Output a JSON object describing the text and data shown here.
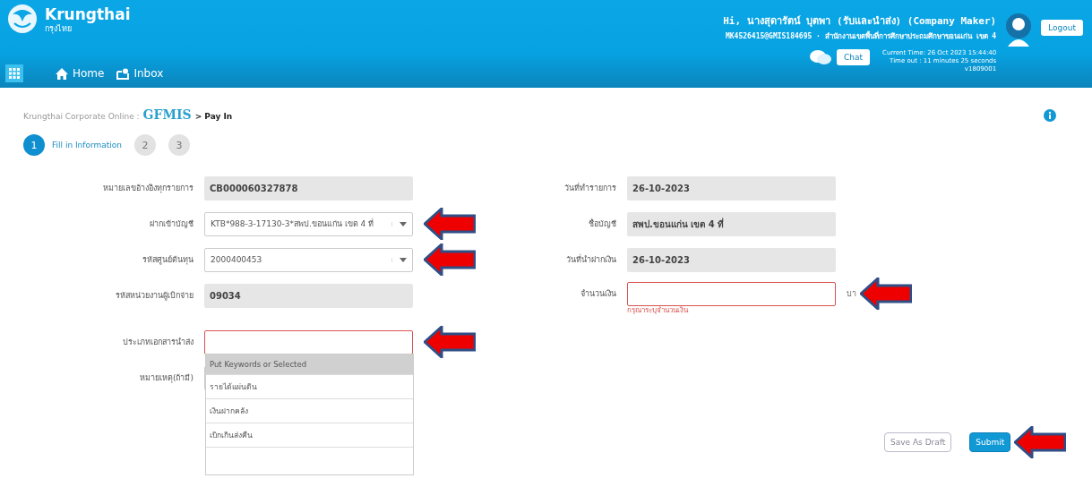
{
  "header": {
    "brand": "Krungthai",
    "brand_sub": "กรุงไทย",
    "nav": [
      {
        "label": "Home"
      },
      {
        "label": "Inbox"
      }
    ],
    "greeting": "Hi, นางสุดารัตน์ บุตพา (รับและนำส่ง) (Company Maker)",
    "user_line": "MK4526415@GMIS184695 · สำนักงานเขตพื้นที่การศึกษาประถมศึกษาขอนแก่น เขต 4",
    "chat_button": "Chat",
    "logout_button": "Logout",
    "current_time": "Current Time: 26 Oct 2023 15:44:40",
    "time_out": "Time out : 11 minutes 25 seconds",
    "version": "v1809001"
  },
  "breadcrumb": {
    "root": "Krungthai Corporate Online :",
    "section": "GFMIS",
    "page": "> Pay In"
  },
  "steps": [
    {
      "number": "1",
      "label": "Fill in Information",
      "selected": true
    },
    {
      "number": "2",
      "selected": false
    },
    {
      "number": "3",
      "selected": false
    }
  ],
  "left_fields": [
    {
      "label": "หมายเลขอ้างอิงทุกรายการ",
      "kind": "readonly",
      "value": "CB000060327878",
      "annotated": false
    },
    {
      "label": "ฝากเข้าบัญชี",
      "kind": "select",
      "value": "KTB*988-3-17130-3*สพป.ขอนแก่น เขต 4 ที่",
      "annotated": true
    },
    {
      "label": "รหัสศูนย์ต้นทุน",
      "kind": "select",
      "value": "2000400453",
      "annotated": true
    },
    {
      "label": "รหัสหน่วยงานผู้เบิกจ่าย",
      "kind": "readonly",
      "value": "09034",
      "annotated": false
    },
    {
      "label": "ประเภทเอกสารนำส่ง",
      "kind": "combo",
      "error": true,
      "annotated": true,
      "options": [
        {
          "label": "Put Keywords or Selected",
          "selected": true
        },
        {
          "label": "รายได้แผ่นดิน",
          "selected": false
        },
        {
          "label": "เงินฝากคลัง",
          "selected": false
        },
        {
          "label": "เบิกเกินส่งคืน",
          "selected": false
        }
      ]
    },
    {
      "label": "หมายเหตุ(ถ้ามี)",
      "kind": "text",
      "annotated": false
    }
  ],
  "right_fields": [
    {
      "label": "วันที่ทำรายการ",
      "kind": "readonly",
      "value": "26-10-2023",
      "annotated": false
    },
    {
      "label": "ชื่อบัญชี",
      "kind": "readonly",
      "value": "สพป.ขอนแก่น เขต 4 ที่",
      "annotated": false
    },
    {
      "label": "วันที่นำฝากเงิน",
      "kind": "readonly",
      "value": "26-10-2023",
      "annotated": false
    },
    {
      "label": "จำนวนเงิน",
      "kind": "text",
      "error": true,
      "error_text": "กรุณาระบุจำนวนเงิน",
      "unit": "บา",
      "annotated": true
    }
  ],
  "buttons": [
    {
      "label": "Save As Draft",
      "kind": "secondary",
      "annotated": false
    },
    {
      "label": "Submit",
      "kind": "primary",
      "annotated": true
    }
  ]
}
